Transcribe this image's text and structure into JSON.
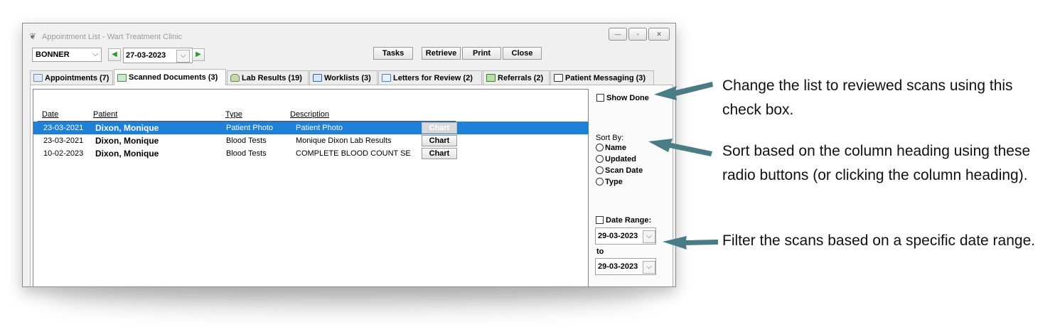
{
  "window": {
    "title": "Appointment List - Wart Treatment Clinic",
    "controls": {
      "minimize": "—",
      "maximize": "▫",
      "close": "✕"
    }
  },
  "toolbar": {
    "provider": "BONNER",
    "date": "27-03-2023",
    "buttons": [
      "Tasks",
      "Retrieve",
      "Print",
      "Close"
    ]
  },
  "tabs": [
    {
      "label": "Appointments (7)",
      "icon": "appointments-icon"
    },
    {
      "label": "Scanned Documents (3)",
      "icon": "scanned-documents-icon",
      "active": true
    },
    {
      "label": "Lab Results (19)",
      "icon": "lab-flask-icon"
    },
    {
      "label": "Worklists (3)",
      "icon": "worklist-check-icon"
    },
    {
      "label": "Letters for Review (2)",
      "icon": "envelope-icon"
    },
    {
      "label": "Referrals (2)",
      "icon": "referrals-icon"
    },
    {
      "label": "Patient Messaging (3)",
      "icon": "person-icon"
    }
  ],
  "table": {
    "headers": [
      "Date",
      "Patient",
      "Type",
      "Description"
    ],
    "rows": [
      {
        "date": "23-03-2021",
        "patient": "Dixon, Monique",
        "type": "Patient Photo",
        "description": "Patient Photo",
        "action": "Chart",
        "selected": true
      },
      {
        "date": "23-03-2021",
        "patient": "Dixon, Monique",
        "type": "Blood Tests",
        "description": "Monique Dixon Lab Results",
        "action": "Chart"
      },
      {
        "date": "10-02-2023",
        "patient": "Dixon, Monique",
        "type": "Blood Tests",
        "description": "COMPLETE BLOOD COUNT SE",
        "action": "Chart"
      }
    ]
  },
  "side": {
    "show_done": "Show Done",
    "sort_by_label": "Sort By:",
    "sort_options": [
      "Name",
      "Updated",
      "Scan Date",
      "Type"
    ],
    "date_range_label": "Date Range:",
    "date_from": "29-03-2023",
    "to_label": "to",
    "date_to": "29-03-2023"
  },
  "annotations": [
    "Change the list to reviewed scans using this check box.",
    "Sort based on the column heading using these radio buttons (or clicking the column heading).",
    "Filter the scans based on a specific date range."
  ],
  "colors": {
    "selection": "#1f80d8",
    "arrow": "#4a7c86",
    "nav_arrow": "#2a9a2a"
  }
}
